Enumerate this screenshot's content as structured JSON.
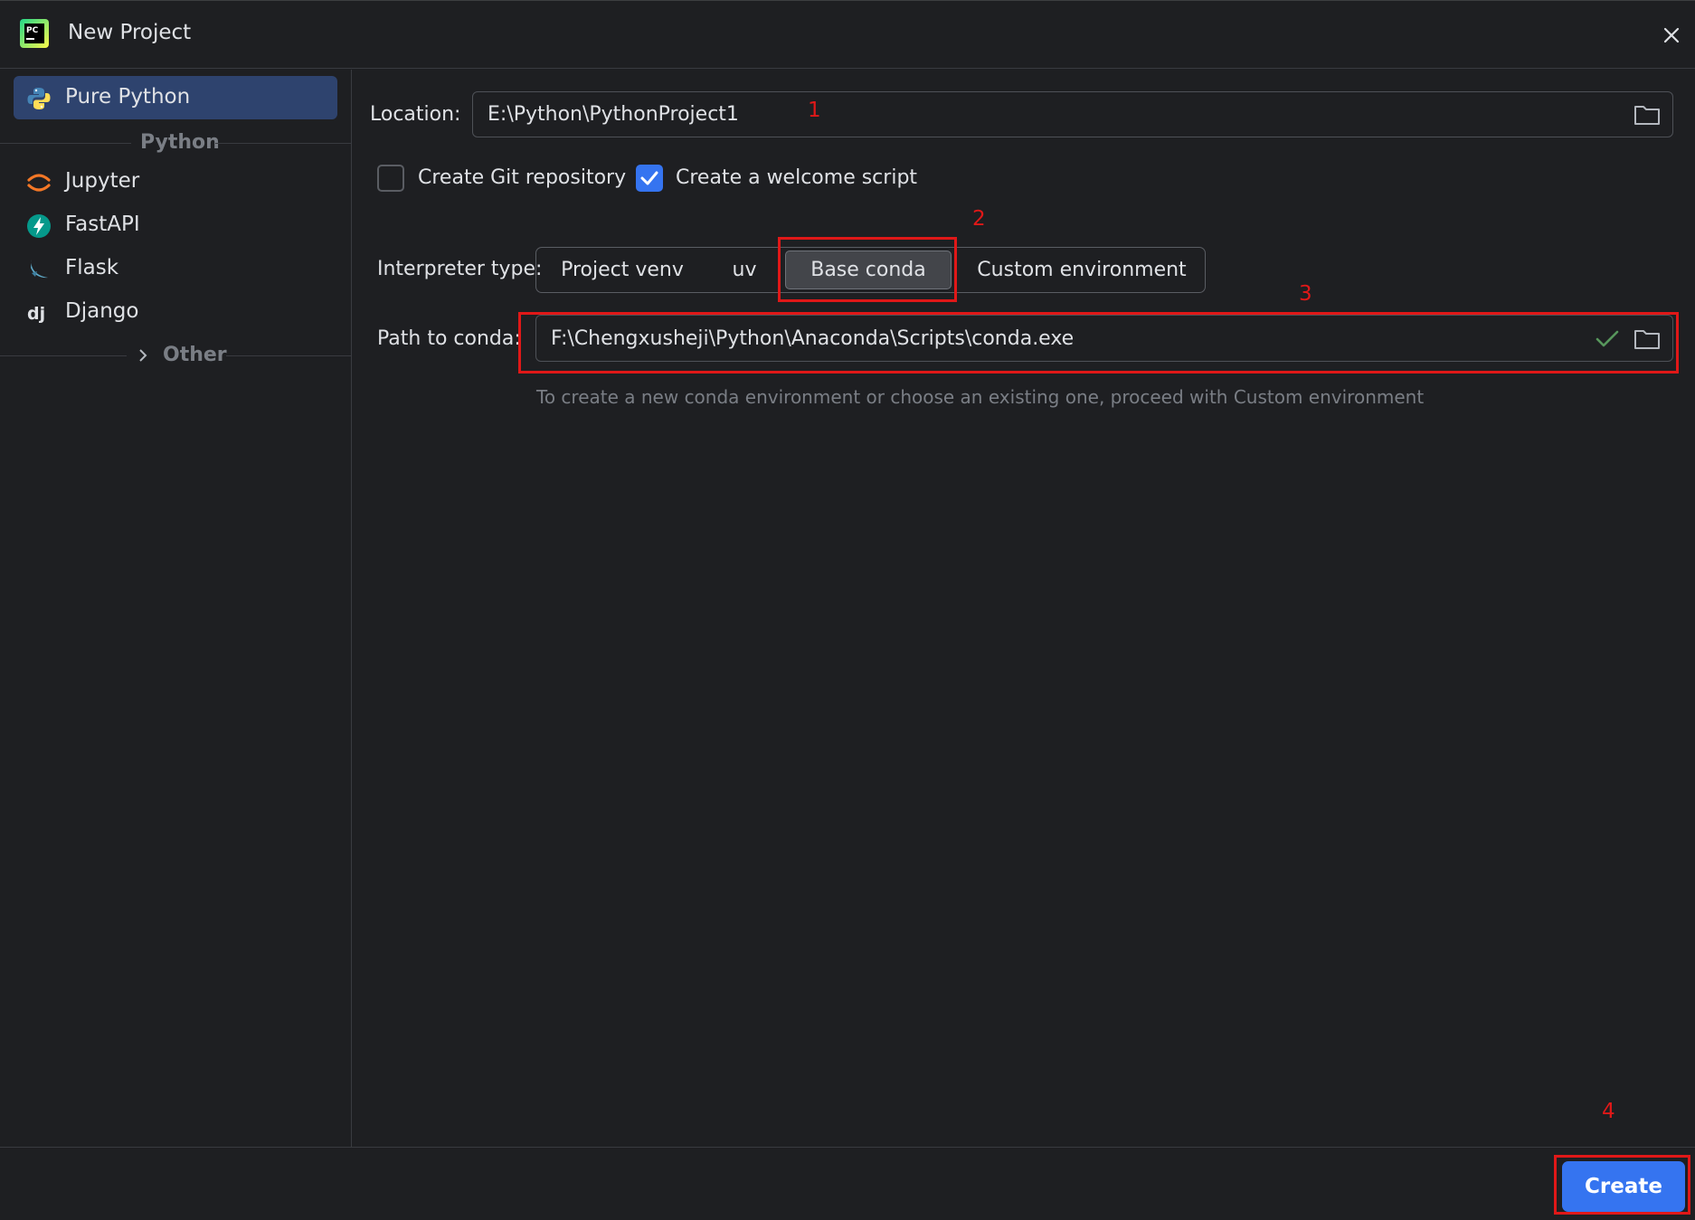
{
  "window": {
    "title": "New Project",
    "logo_text": "PC"
  },
  "sidebar": {
    "selected": {
      "label": "Pure Python"
    },
    "group_label": "Python",
    "items": [
      {
        "label": "Jupyter"
      },
      {
        "label": "FastAPI"
      },
      {
        "label": "Flask"
      },
      {
        "label": "Django"
      }
    ],
    "other_label": "Other"
  },
  "form": {
    "location_label": "Location:",
    "location_value": "E:\\Python\\PythonProject1",
    "git_label": "Create Git repository",
    "git_checked": false,
    "welcome_label": "Create a welcome script",
    "welcome_checked": true,
    "interpreter_label": "Interpreter type:",
    "interpreter_options": [
      "Project venv",
      "uv",
      "Base conda",
      "Custom environment"
    ],
    "interpreter_selected": "Base conda",
    "conda_label": "Path to conda:",
    "conda_value": "F:\\Chengxusheji\\Python\\Anaconda\\Scripts\\conda.exe",
    "hint": "To create a new conda environment or choose an existing one, proceed with Custom environment"
  },
  "annotations": [
    "1",
    "2",
    "3",
    "4"
  ],
  "footer": {
    "create_label": "Create"
  },
  "colors": {
    "accent": "#3574f0",
    "annotation": "#e01818",
    "selection": "#2e436e"
  }
}
